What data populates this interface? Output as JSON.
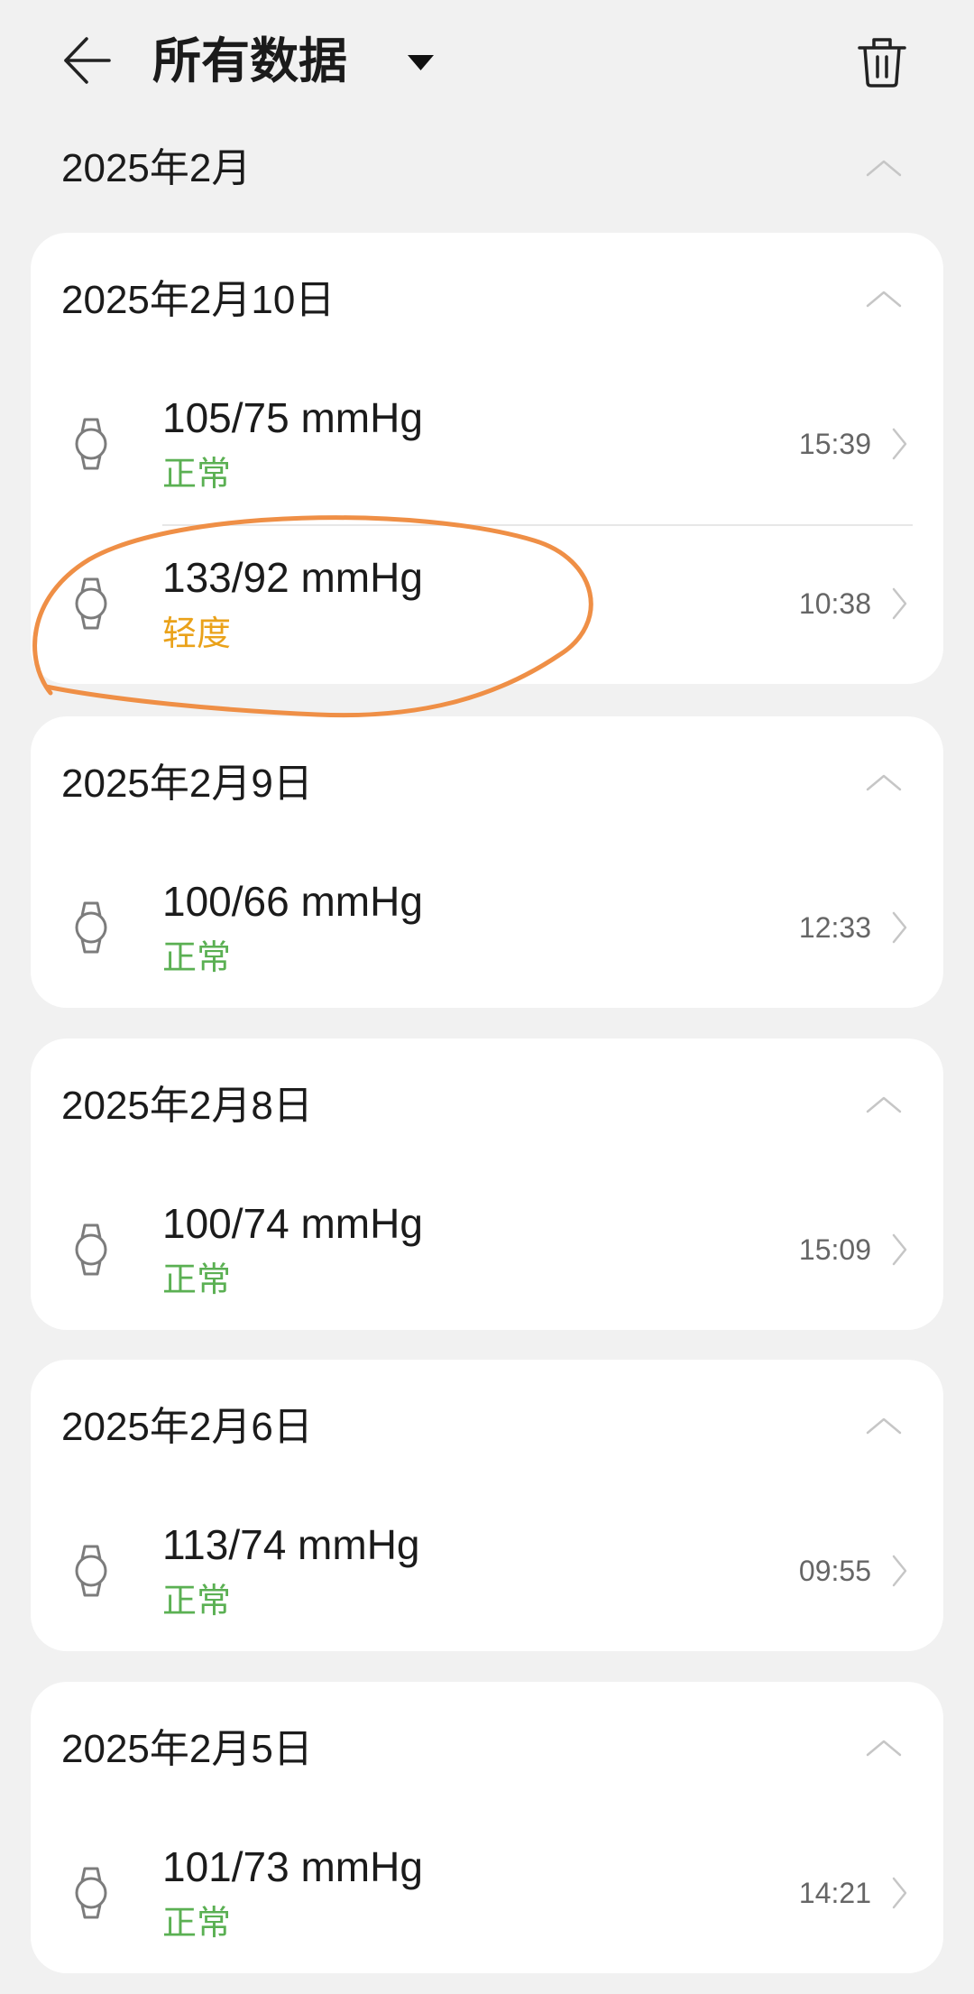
{
  "header": {
    "title": "所有数据",
    "back_icon": "back-arrow-icon",
    "dropdown_icon": "dropdown-triangle-icon",
    "delete_icon": "trash-icon"
  },
  "month": {
    "label": "2025年2月",
    "toggle_icon": "chevron-up-icon"
  },
  "record_icon": "watch-icon",
  "record_arrow_icon": "chevron-right-icon",
  "days": [
    {
      "date": "2025年2月10日",
      "records": [
        {
          "value": "105/75 mmHg",
          "status": "正常",
          "status_color": "#5bb053",
          "time": "15:39"
        },
        {
          "value": "133/92 mmHg",
          "status": "轻度",
          "status_color": "#eaa21a",
          "time": "10:38"
        }
      ]
    },
    {
      "date": "2025年2月9日",
      "records": [
        {
          "value": "100/66 mmHg",
          "status": "正常",
          "status_color": "#5bb053",
          "time": "12:33"
        }
      ]
    },
    {
      "date": "2025年2月8日",
      "records": [
        {
          "value": "100/74 mmHg",
          "status": "正常",
          "status_color": "#5bb053",
          "time": "15:09"
        }
      ]
    },
    {
      "date": "2025年2月6日",
      "records": [
        {
          "value": "113/74 mmHg",
          "status": "正常",
          "status_color": "#5bb053",
          "time": "09:55"
        }
      ]
    },
    {
      "date": "2025年2月5日",
      "records": [
        {
          "value": "101/73 mmHg",
          "status": "正常",
          "status_color": "#5bb053",
          "time": "14:21"
        }
      ]
    }
  ],
  "colors": {
    "background": "#f1f1f1",
    "card": "#ffffff",
    "annotation": "#ef8f46"
  }
}
